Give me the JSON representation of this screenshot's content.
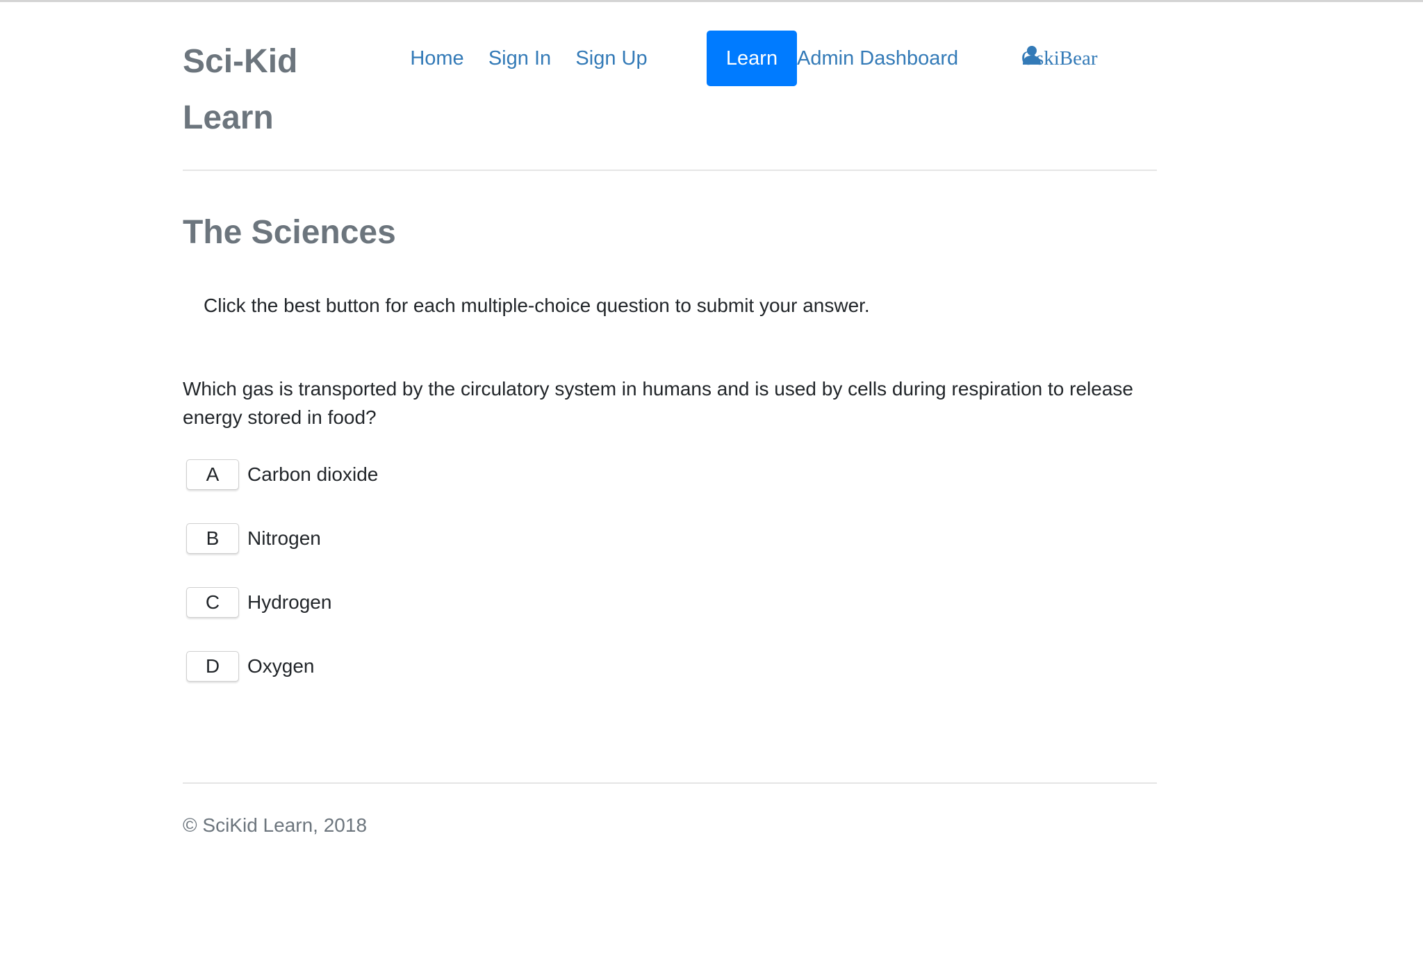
{
  "brand": {
    "line1": "Sci-Kid",
    "line2": "Learn"
  },
  "nav": {
    "items": [
      {
        "label": "Home"
      },
      {
        "label": "Sign In"
      },
      {
        "label": "Sign Up"
      },
      {
        "label": "Learn",
        "active": true
      },
      {
        "label": "Admin Dashboard"
      }
    ],
    "user": {
      "icon": "user-icon",
      "name": "OskiBear"
    }
  },
  "main": {
    "title": "The Sciences",
    "instructions": "Click the best button for each multiple-choice question to submit your answer.",
    "question": "Which gas is transported by the circulatory system in humans and is used by cells during respiration to release energy stored in food?",
    "choices": [
      {
        "letter": "A",
        "text": "Carbon dioxide"
      },
      {
        "letter": "B",
        "text": "Nitrogen"
      },
      {
        "letter": "C",
        "text": "Hydrogen"
      },
      {
        "letter": "D",
        "text": "Oxygen"
      }
    ]
  },
  "footer": {
    "text": "© SciKid Learn, 2018"
  },
  "colors": {
    "link": "#337ab7",
    "active_bg": "#007bff",
    "heading": "#6c757d",
    "text": "#212529"
  }
}
